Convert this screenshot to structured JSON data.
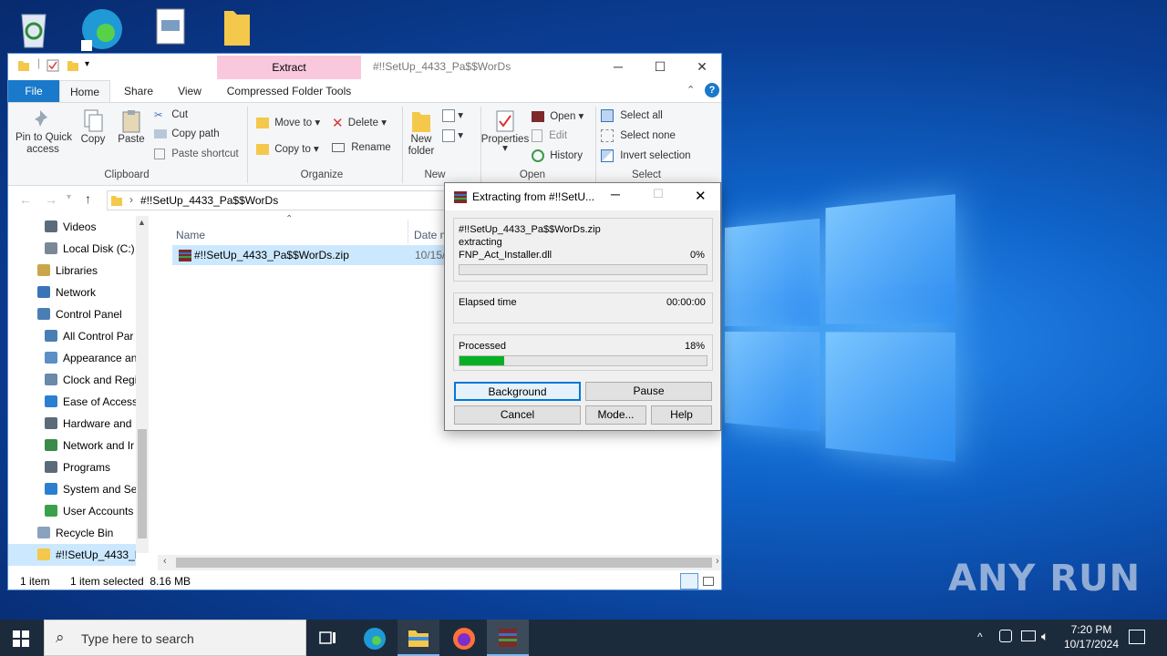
{
  "explorer": {
    "title": "#!!SetUp_4433_Pa$$WorDs",
    "context_tab": "Extract",
    "tabs": [
      "File",
      "Home",
      "Share",
      "View",
      "Compressed Folder Tools"
    ],
    "clipboard": {
      "pin": "Pin to Quick\naccess",
      "copy": "Copy",
      "paste": "Paste",
      "cut": "Cut",
      "copy_path": "Copy path",
      "paste_shortcut": "Paste shortcut",
      "group": "Clipboard"
    },
    "organize": {
      "move_to": "Move to",
      "copy_to": "Copy to",
      "delete": "Delete",
      "rename": "Rename",
      "group": "Organize"
    },
    "new": {
      "new_folder": "New\nfolder",
      "group": "New"
    },
    "open": {
      "properties": "Properties",
      "open": "Open",
      "edit": "Edit",
      "history": "History",
      "group": "Open"
    },
    "select": {
      "select_all": "Select all",
      "select_none": "Select none",
      "invert": "Invert selection",
      "group": "Select"
    },
    "address": "#!!SetUp_4433_Pa$$WorDs",
    "sidebar": [
      "Videos",
      "Local Disk (C:)",
      "Libraries",
      "Network",
      "Control Panel",
      "All Control Par",
      "Appearance an",
      "Clock and Regi",
      "Ease of Access",
      "Hardware and",
      "Network and Ir",
      "Programs",
      "System and Sec",
      "User Accounts",
      "Recycle Bin",
      "#!!SetUp_4433_P"
    ],
    "columns": {
      "name": "Name",
      "date": "Date mo"
    },
    "file": {
      "name": "#!!SetUp_4433_Pa$$WorDs.zip",
      "date": "10/15/2"
    },
    "status": {
      "count": "1 item",
      "selected": "1 item selected  8.16 MB"
    }
  },
  "dialog": {
    "title": "Extracting from #!!SetU...",
    "archive": "#!!SetUp_4433_Pa$$WorDs.zip",
    "action": "extracting",
    "current_file": "FNP_Act_Installer.dll",
    "file_percent_label": "0%",
    "file_progress": 0,
    "elapsed_label": "Elapsed time",
    "elapsed": "00:00:00",
    "processed_label": "Processed",
    "processed_percent_label": "18%",
    "processed_progress": 0.18,
    "buttons": {
      "background": "Background",
      "pause": "Pause",
      "cancel": "Cancel",
      "mode": "Mode...",
      "help": "Help"
    }
  },
  "taskbar": {
    "search_placeholder": "Type here to search",
    "time": "7:20 PM",
    "date": "10/17/2024"
  },
  "watermark": "ANY RUN",
  "colors": {
    "progress": "#06b025",
    "accent": "#1979ca"
  }
}
